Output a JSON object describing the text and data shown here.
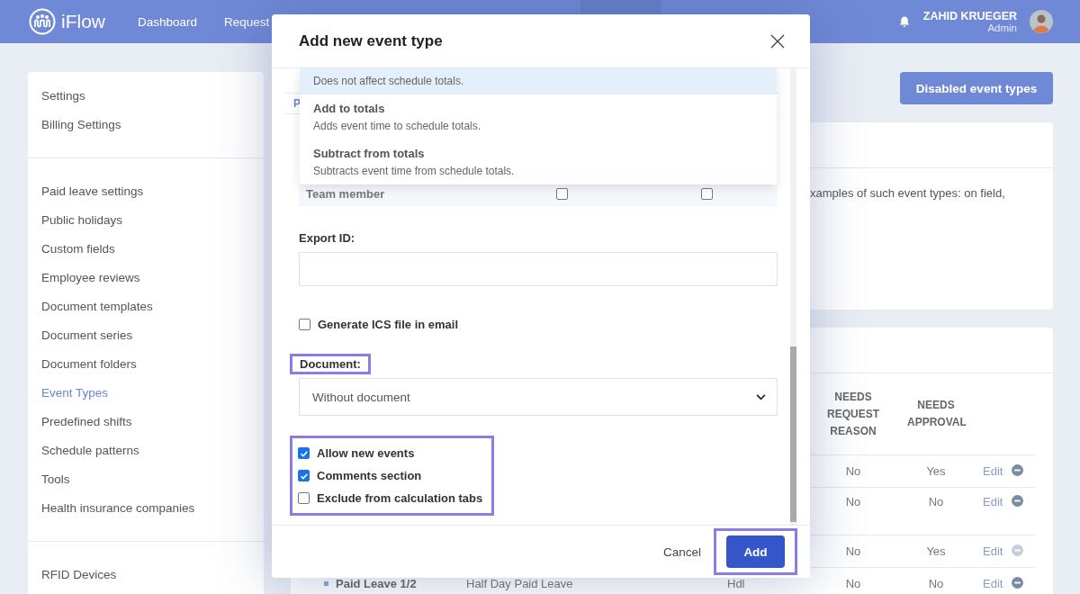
{
  "top_bar": {
    "logo": "iFlow",
    "nav": [
      {
        "label": "Dashboard"
      },
      {
        "label": "Request"
      }
    ],
    "user": {
      "name": "ZAHID KRUEGER",
      "role": "Admin"
    }
  },
  "sidebar": {
    "groups": [
      [
        {
          "label": "Settings",
          "selected": false
        },
        {
          "label": "Billing Settings",
          "selected": false
        }
      ],
      [
        {
          "label": "Paid leave settings",
          "selected": false
        },
        {
          "label": "Public holidays",
          "selected": false
        },
        {
          "label": "Custom fields",
          "selected": false
        },
        {
          "label": "Employee reviews",
          "selected": false
        },
        {
          "label": "Document templates",
          "selected": false
        },
        {
          "label": "Document series",
          "selected": false
        },
        {
          "label": "Document folders",
          "selected": false
        },
        {
          "label": "Event Types",
          "selected": true
        },
        {
          "label": "Predefined shifts",
          "selected": false
        },
        {
          "label": "Schedule patterns",
          "selected": false
        },
        {
          "label": "Tools",
          "selected": false
        },
        {
          "label": "Health insurance companies",
          "selected": false
        }
      ],
      [
        {
          "label": "RFID Devices",
          "selected": false
        }
      ]
    ]
  },
  "toolbar": {
    "button": "Disabled event types"
  },
  "info_card": {
    "text": "xamples of such event types: on field,"
  },
  "event_types_table": {
    "columns": [
      {
        "label": "NEEDS REQUEST REASON"
      },
      {
        "label": "NEEDS APPROVAL"
      }
    ],
    "rows": [
      {
        "needs_request_reason": "No",
        "needs_approval": "Yes",
        "action": "Edit",
        "removable": true
      },
      {
        "needs_request_reason": "No",
        "needs_approval": "No",
        "action": "Edit",
        "removable": true
      },
      {
        "needs_request_reason": "No",
        "needs_approval": "Yes",
        "action": "Edit",
        "removable": false
      },
      {
        "name": "Paid Leave 1/2",
        "description": "Half Day Paid Leave",
        "code": "Hdl",
        "needs_request_reason": "No",
        "needs_approval": "No",
        "action": "Edit",
        "removable": true
      }
    ]
  },
  "modal": {
    "title": "Add new event type",
    "tabs": [
      {
        "label": "P"
      }
    ],
    "permissions": [
      {
        "role": "Team member",
        "checks": [
          false,
          false
        ]
      }
    ],
    "dropdown": {
      "options": [
        {
          "description": "Does not affect schedule totals.",
          "selected": true
        },
        {
          "title": "Add to totals",
          "description": "Adds event time to schedule totals.",
          "selected": false
        },
        {
          "title": "Subtract from totals",
          "description": "Subtracts event time from schedule totals.",
          "selected": false
        }
      ]
    },
    "export_id": {
      "label": "Export ID:"
    },
    "ics": {
      "label": "Generate ICS file in email",
      "checked": false
    },
    "document": {
      "label": "Document:",
      "value": "Without document",
      "highlighted": true
    },
    "flags": {
      "highlighted": true,
      "items": [
        {
          "label": "Allow new events",
          "checked": true
        },
        {
          "label": "Comments section",
          "checked": true
        },
        {
          "label": "Exclude from calculation tabs",
          "checked": false
        }
      ]
    },
    "footer": {
      "cancel": "Cancel",
      "add": "Add",
      "add_highlighted": true
    }
  }
}
